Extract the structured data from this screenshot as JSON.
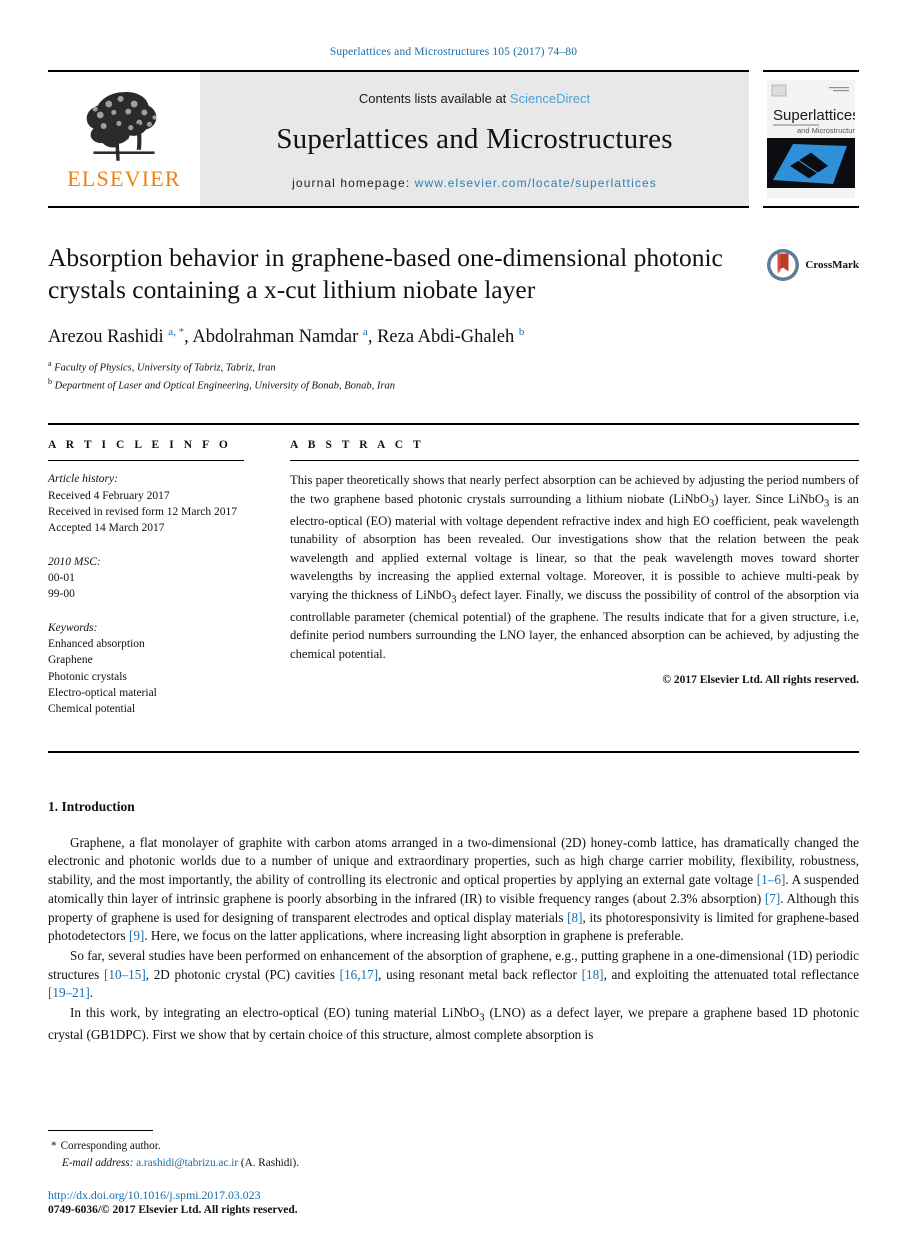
{
  "running_head": "Superlattices and Microstructures 105 (2017) 74–80",
  "masthead": {
    "publisher_name": "ELSEVIER",
    "publisher_logo_alt": "elsevier-tree-logo",
    "contents_prefix": "Contents lists available at ",
    "contents_link": "ScienceDirect",
    "journal_title": "Superlattices and Microstructures",
    "homepage_prefix": "journal homepage: ",
    "homepage_url": "www.elsevier.com/locate/superlattices",
    "cover": {
      "title_main": "Superlattices",
      "title_sub": "and Microstructures"
    }
  },
  "article": {
    "title": "Absorption behavior in graphene-based one-dimensional photonic crystals containing a x-cut lithium niobate layer",
    "authors_html": "Arezou Rashidi <sup>a, *</sup>, Abdolrahman Namdar <sup>a</sup>, Reza Abdi-Ghaleh <sup>b</sup>",
    "affiliation_a": "Faculty of Physics, University of Tabriz, Tabriz, Iran",
    "affiliation_b": "Department of Laser and Optical Engineering, University of Bonab, Bonab, Iran",
    "crossmark_label": "CrossMark"
  },
  "info": {
    "heading": "A R T I C L E  I N F O",
    "history_label": "Article history:",
    "history": [
      "Received 4 February 2017",
      "Received in revised form 12 March 2017",
      "Accepted 14 March 2017"
    ],
    "msc_label": "2010 MSC:",
    "msc": [
      "00-01",
      "99-00"
    ],
    "keywords_label": "Keywords:",
    "keywords": [
      "Enhanced absorption",
      "Graphene",
      "Photonic crystals",
      "Electro-optical material",
      "Chemical potential"
    ]
  },
  "abstract": {
    "heading": "A B S T R A C T",
    "text_html": "This paper theoretically shows that nearly perfect absorption can be achieved by adjusting the period numbers of the two graphene based photonic crystals surrounding a lithium niobate (LiNbO<sub>3</sub>) layer. Since LiNbO<sub>3</sub> is an electro-optical (EO) material with voltage dependent refractive index and high EO coefficient, peak wavelength tunability of absorption has been revealed. Our investigations show that the relation between the peak wavelength and applied external voltage is linear, so that the peak wavelength moves toward shorter wavelengths by increasing the applied external voltage. Moreover, it is possible to achieve multi-peak by varying the thickness of LiNbO<sub>3</sub> defect layer. Finally, we discuss the possibility of control of the absorption via controllable parameter (chemical potential) of the graphene. The results indicate that for a given structure, i.e, definite period numbers surrounding the LNO layer, the enhanced absorption can be achieved, by adjusting the chemical potential.",
    "copyright": "© 2017 Elsevier Ltd. All rights reserved."
  },
  "introduction": {
    "heading": "1. Introduction",
    "paragraph_1_html": "Graphene, a flat monolayer of graphite with carbon atoms arranged in a two-dimensional (2D) honey-comb lattice, has dramatically changed the electronic and photonic worlds due to a number of unique and extraordinary properties, such as high charge carrier mobility, flexibility, robustness, stability, and the most importantly, the ability of controlling its electronic and optical properties by applying an external gate voltage <span class=\"ref\">[1&#8211;6]</span>. A suspended atomically thin layer of intrinsic graphene is poorly absorbing in the infrared (IR) to visible frequency ranges (about 2.3% absorption) <span class=\"ref\">[7]</span>. Although this property of graphene is used for designing of transparent electrodes and optical display materials <span class=\"ref\">[8]</span>, its photoresponsivity is limited for graphene-based photodetectors <span class=\"ref\">[9]</span>. Here, we focus on the latter applications, where increasing light absorption in graphene is preferable.",
    "paragraph_2_html": "So far, several studies have been performed on enhancement of the absorption of graphene, e.g., putting graphene in a one-dimensional (1D) periodic structures <span class=\"ref\">[10&#8211;15]</span>, 2D photonic crystal (PC) cavities <span class=\"ref\">[16,17]</span>, using resonant metal back reflector <span class=\"ref\">[18]</span>, and exploiting the attenuated total reflectance <span class=\"ref\">[19&#8211;21]</span>.",
    "paragraph_3_html": "In this work, by integrating an electro-optical (EO) tuning material LiNbO<sub>3</sub> (LNO) as a defect layer, we prepare a graphene based 1D photonic crystal (GB1DPC). First we show that by certain choice of this structure, almost complete absorption is"
  },
  "footer": {
    "corresponding_marker": "*",
    "corresponding_label": "Corresponding author.",
    "email_label": "E-mail address:",
    "email": "a.rashidi@tabrizu.ac.ir",
    "email_owner": "(A. Rashidi).",
    "doi": "http://dx.doi.org/10.1016/j.spmi.2017.03.023",
    "issn_line": "0749-6036/© 2017 Elsevier Ltd. All rights reserved."
  },
  "colors": {
    "link_blue": "#1b6ca8",
    "science_direct_blue": "#4ba3dd",
    "elsevier_orange": "#f07f13",
    "masthead_gray": "#e8e8e8"
  }
}
